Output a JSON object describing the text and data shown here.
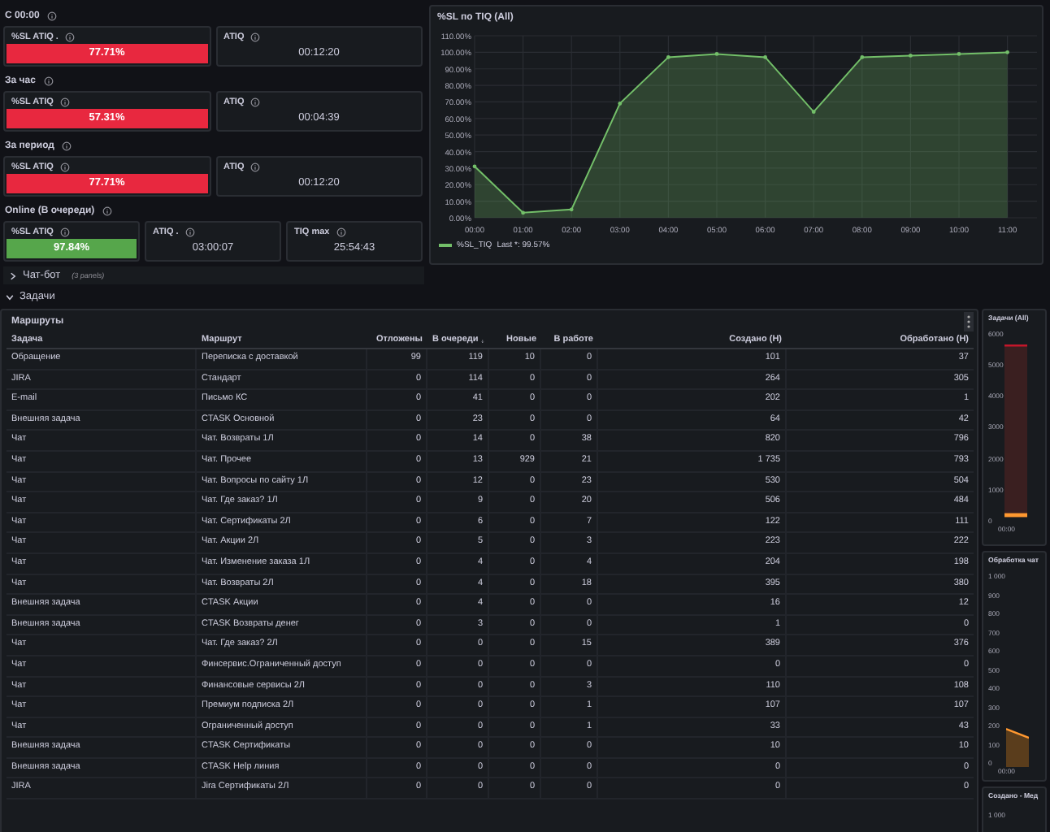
{
  "stat_sections": [
    {
      "label": "С 00:00",
      "items": [
        {
          "title": "%SL ATIQ .",
          "value": "77.71%",
          "kind": "bar",
          "color": "#e8283f"
        },
        {
          "title": "ATIQ",
          "value": "00:12:20",
          "kind": "plain"
        }
      ]
    },
    {
      "label": "За час",
      "items": [
        {
          "title": "%SL ATIQ",
          "value": "57.31%",
          "kind": "bar",
          "color": "#e8283f"
        },
        {
          "title": "ATIQ",
          "value": "00:04:39",
          "kind": "plain"
        }
      ]
    },
    {
      "label": "За период",
      "items": [
        {
          "title": "%SL ATIQ",
          "value": "77.71%",
          "kind": "bar",
          "color": "#e8283f"
        },
        {
          "title": "ATIQ",
          "value": "00:12:20",
          "kind": "plain"
        }
      ]
    },
    {
      "label": "Online (В очереди)",
      "items": [
        {
          "title": "%SL ATIQ",
          "value": "97.84%",
          "kind": "bar",
          "color": "#56a64b"
        },
        {
          "title": "ATIQ .",
          "value": "03:00:07",
          "kind": "plain"
        },
        {
          "title": "TIQ max",
          "value": "25:54:43",
          "kind": "plain"
        }
      ]
    }
  ],
  "sl_chart": {
    "legend_value": "Last *: 99.57%",
    "chart_data": {
      "type": "area",
      "title": "%SL по TIQ (All)",
      "categories": [
        "00:00",
        "01:00",
        "02:00",
        "03:00",
        "04:00",
        "05:00",
        "06:00",
        "07:00",
        "08:00",
        "09:00",
        "10:00",
        "11:00"
      ],
      "series": [
        {
          "name": "%SL_TIQ",
          "color": "#73bf69",
          "values": [
            31,
            3,
            5,
            69,
            97,
            99,
            97,
            64,
            97,
            98,
            99,
            100
          ]
        }
      ],
      "grid": true,
      "ylim": [
        0,
        110
      ],
      "yticks": [
        {
          "value": 0,
          "label": "0.00%"
        },
        {
          "value": 10,
          "label": "10.00%"
        },
        {
          "value": 20,
          "label": "20.00%"
        },
        {
          "value": 30,
          "label": "30.00%"
        },
        {
          "value": 40,
          "label": "40.00%"
        },
        {
          "value": 50,
          "label": "50.00%"
        },
        {
          "value": 60,
          "label": "60.00%"
        },
        {
          "value": 70,
          "label": "70.00%"
        },
        {
          "value": 80,
          "label": "80.00%"
        },
        {
          "value": 90,
          "label": "90.00%"
        },
        {
          "value": 100,
          "label": "100.00%"
        },
        {
          "value": 110,
          "label": "110.00%"
        }
      ]
    }
  },
  "dashboard_rows": [
    {
      "title": "Чат-бот",
      "note": "(3 panels)",
      "expanded": false
    },
    {
      "title": "Задачи",
      "expanded": true
    }
  ],
  "table": {
    "title": "Маршруты",
    "columns": [
      {
        "label": "Задача",
        "sorted": false
      },
      {
        "label": "Маршрут",
        "sorted": false
      },
      {
        "label": "Отложены",
        "sorted": false
      },
      {
        "label": "В очереди",
        "sorted": true
      },
      {
        "label": "Новые",
        "sorted": false
      },
      {
        "label": "В работе",
        "sorted": false
      },
      {
        "label": "Создано (Н)",
        "sorted": false
      },
      {
        "label": "Обработано (Н)",
        "sorted": false
      }
    ],
    "rows": [
      [
        "Обращение",
        "Переписка с доставкой",
        "99",
        "119",
        "10",
        "0",
        "101",
        "37"
      ],
      [
        "JIRA",
        "Стандарт",
        "0",
        "114",
        "0",
        "0",
        "264",
        "305"
      ],
      [
        "E-mail",
        "Письмо КС",
        "0",
        "41",
        "0",
        "0",
        "202",
        "1"
      ],
      [
        "Внешняя задача",
        "CTASK Основной",
        "0",
        "23",
        "0",
        "0",
        "64",
        "42"
      ],
      [
        "Чат",
        "Чат. Возвраты 1Л",
        "0",
        "14",
        "0",
        "38",
        "820",
        "796"
      ],
      [
        "Чат",
        "Чат. Прочее",
        "0",
        "13",
        "929",
        "21",
        "1 735",
        "793"
      ],
      [
        "Чат",
        "Чат. Вопросы по сайту 1Л",
        "0",
        "12",
        "0",
        "23",
        "530",
        "504"
      ],
      [
        "Чат",
        "Чат. Где заказ? 1Л",
        "0",
        "9",
        "0",
        "20",
        "506",
        "484"
      ],
      [
        "Чат",
        "Чат. Сертификаты 2Л",
        "0",
        "6",
        "0",
        "7",
        "122",
        "111"
      ],
      [
        "Чат",
        "Чат. Акции 2Л",
        "0",
        "5",
        "0",
        "3",
        "223",
        "222"
      ],
      [
        "Чат",
        "Чат. Изменение заказа 1Л",
        "0",
        "4",
        "0",
        "4",
        "204",
        "198"
      ],
      [
        "Чат",
        "Чат. Возвраты 2Л",
        "0",
        "4",
        "0",
        "18",
        "395",
        "380"
      ],
      [
        "Внешняя задача",
        "CTASK Акции",
        "0",
        "4",
        "0",
        "0",
        "16",
        "12"
      ],
      [
        "Внешняя задача",
        "CTASK Возвраты денег",
        "0",
        "3",
        "0",
        "0",
        "1",
        "0"
      ],
      [
        "Чат",
        "Чат. Где заказ? 2Л",
        "0",
        "0",
        "0",
        "15",
        "389",
        "376"
      ],
      [
        "Чат",
        "Финсервис.Ограниченный доступ",
        "0",
        "0",
        "0",
        "0",
        "0",
        "0"
      ],
      [
        "Чат",
        "Финансовые сервисы 2Л",
        "0",
        "0",
        "0",
        "3",
        "110",
        "108"
      ],
      [
        "Чат",
        "Премиум подписка 2Л",
        "0",
        "0",
        "0",
        "1",
        "107",
        "107"
      ],
      [
        "Чат",
        "Ограниченный доступ",
        "0",
        "0",
        "0",
        "1",
        "33",
        "43"
      ],
      [
        "Внешняя задача",
        "CTASK Сертификаты",
        "0",
        "0",
        "0",
        "0",
        "10",
        "10"
      ],
      [
        "Внешняя задача",
        "CTASK Help линия",
        "0",
        "0",
        "0",
        "0",
        "0",
        "0"
      ],
      [
        "JIRA",
        "Jira Сертификаты 2Л",
        "0",
        "0",
        "0",
        "0",
        "0",
        "0"
      ]
    ]
  },
  "side_panels": [
    {
      "title": "Задачи (All)",
      "kind": "lines",
      "y_ticks": [
        "6000",
        "5000",
        "4000",
        "3000",
        "2000",
        "1000",
        "0"
      ],
      "x_tick": "00:00"
    },
    {
      "title": "Обработка чат",
      "kind": "area",
      "y_ticks": [
        "1 000",
        "900",
        "800",
        "700",
        "600",
        "500",
        "400",
        "300",
        "200",
        "100",
        "0"
      ],
      "x_tick": "00:00"
    },
    {
      "title": "Создано - Мед",
      "kind": "stub",
      "y_ticks": [
        "1 000"
      ]
    }
  ]
}
